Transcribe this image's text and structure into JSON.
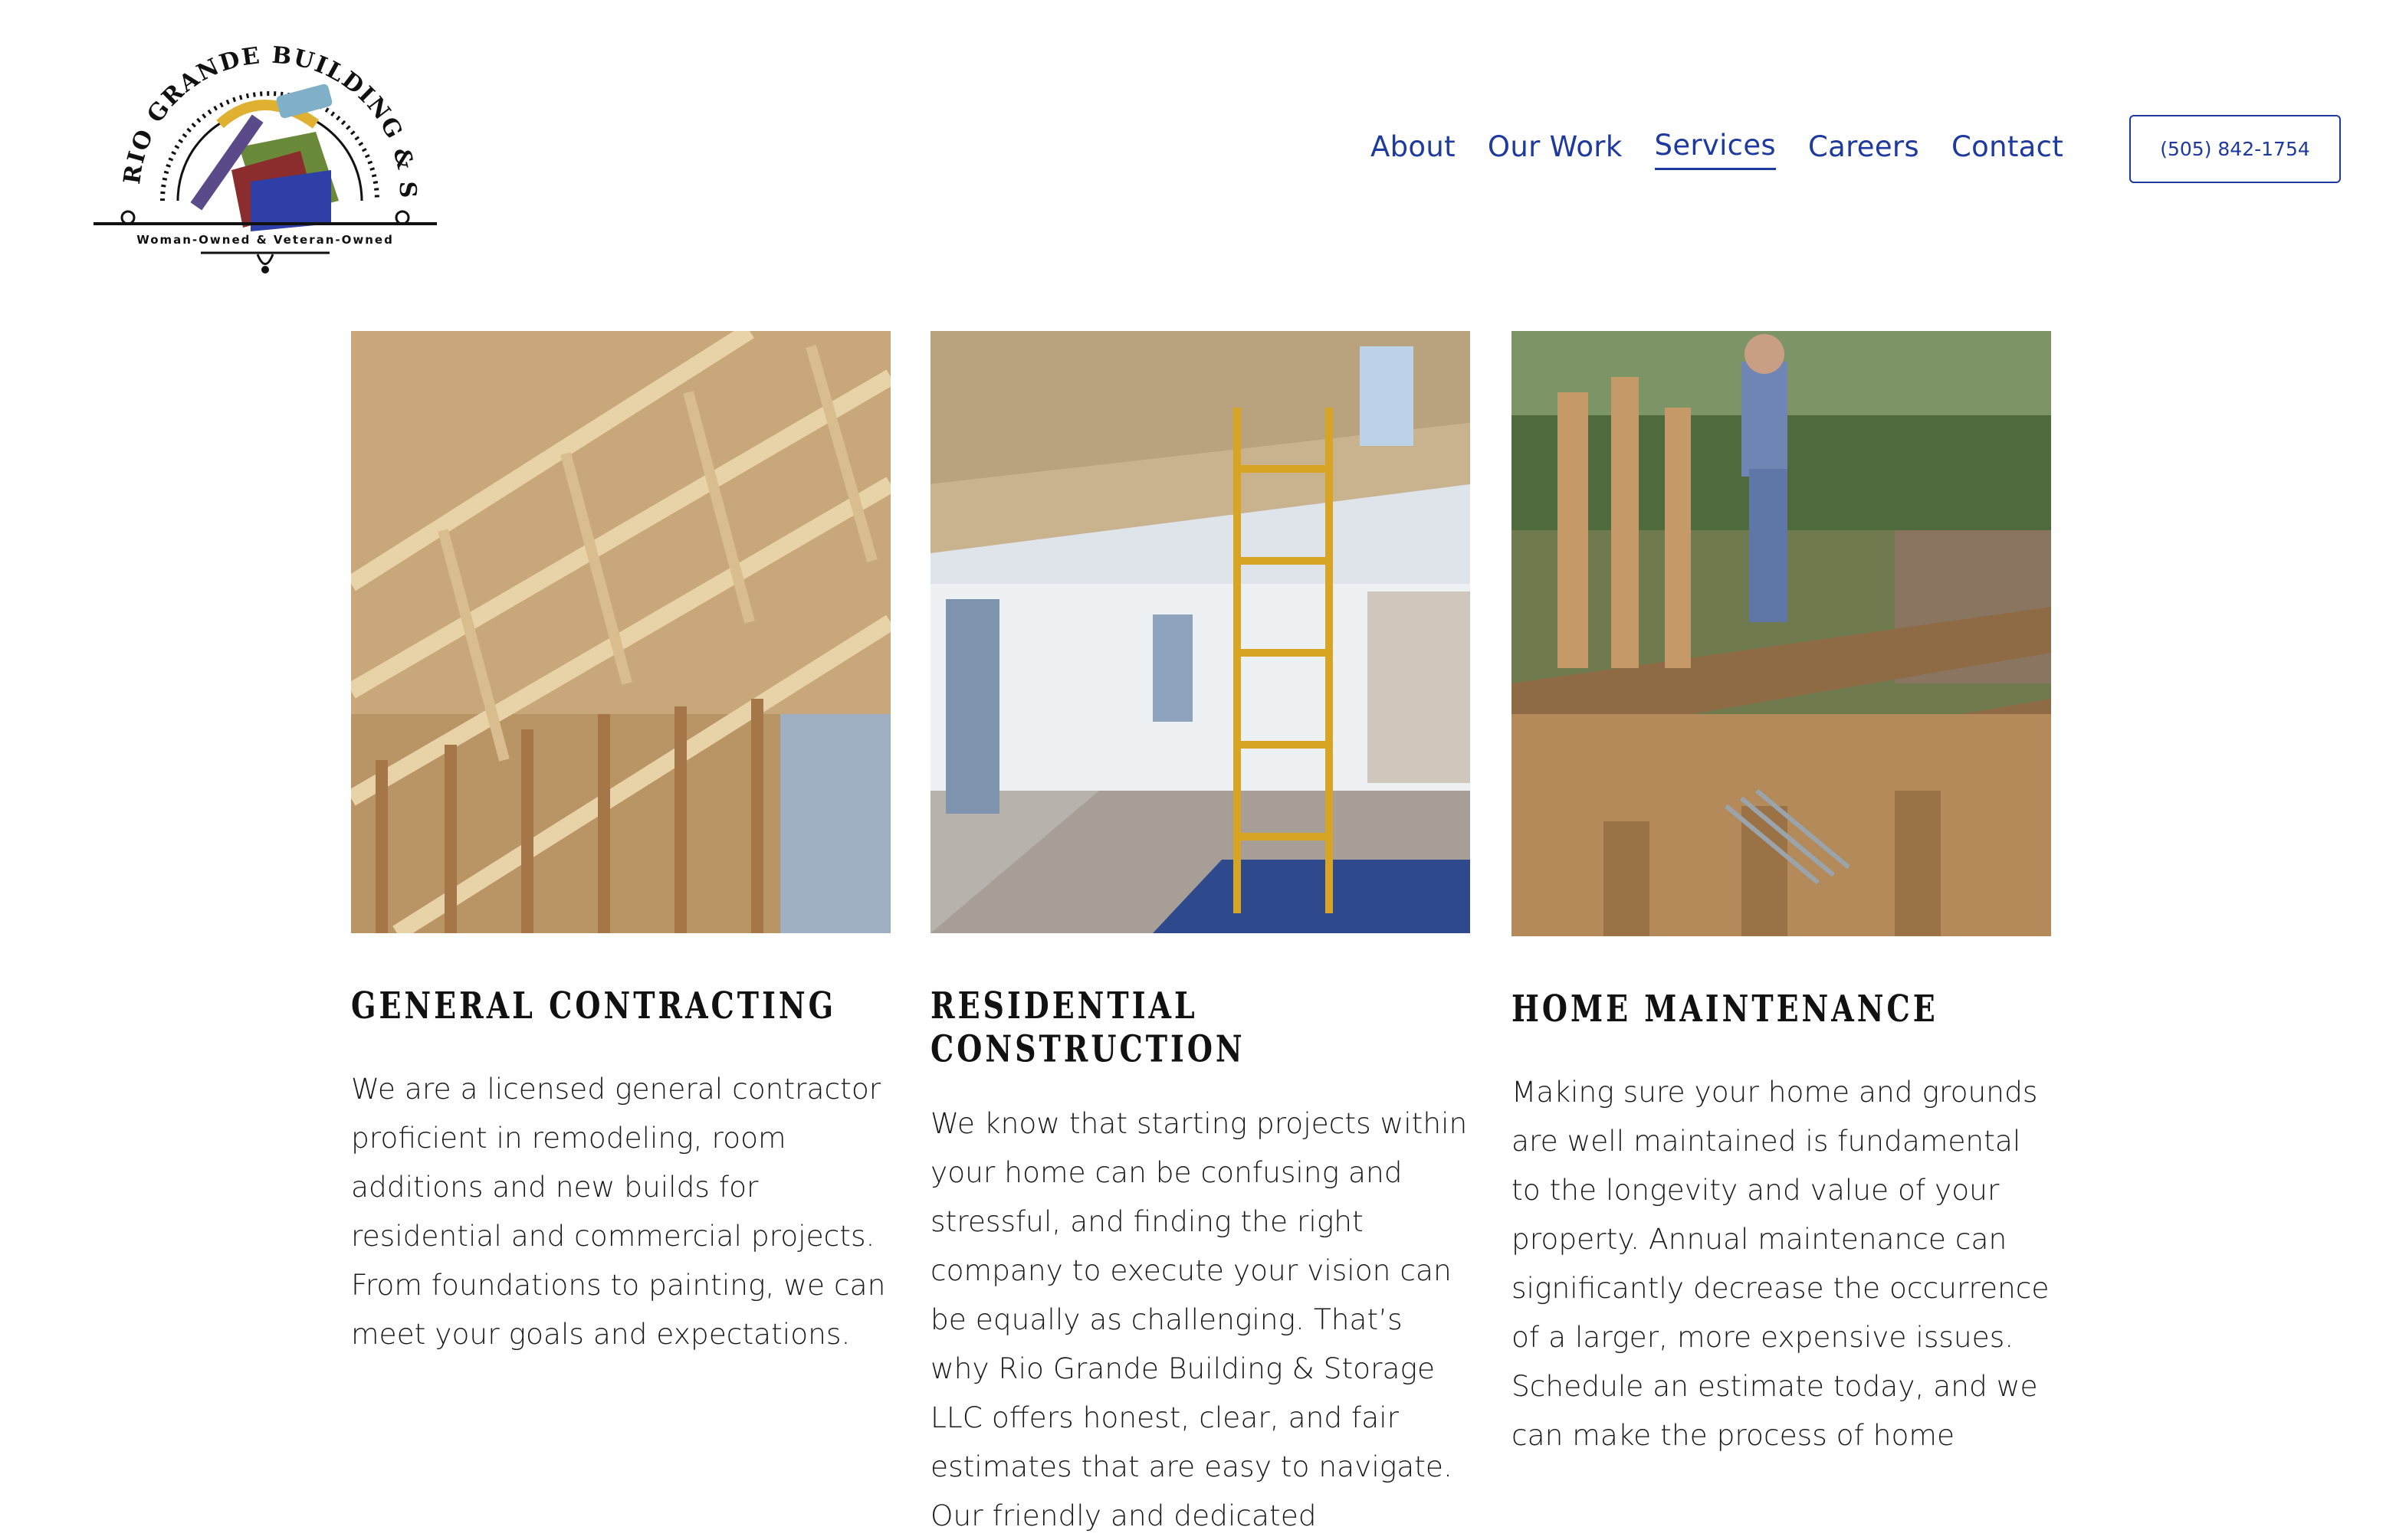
{
  "logo": {
    "arc_text": "RIO GRANDE BUILDING & STORAGE",
    "tagline": "Woman-Owned  &  Veteran-Owned"
  },
  "nav": {
    "items": [
      {
        "label": "About"
      },
      {
        "label": "Our Work"
      },
      {
        "label": "Services",
        "active": true
      },
      {
        "label": "Careers"
      },
      {
        "label": "Contact"
      }
    ]
  },
  "phone_button": {
    "label": "(505) 842-1754"
  },
  "colors": {
    "accent": "#1f3a9e",
    "background": "#ffffff",
    "text": "#1a1a1a"
  },
  "services": [
    {
      "title": "General Contracting",
      "image_icon": "roof-trusses-photo",
      "body": "We are a licensed general contractor proficient in remodeling, room additions and new builds for residential and commercial projects. From foundations to painting, we can meet your goals and expectations."
    },
    {
      "title": "Residential Construction",
      "image_icon": "interior-scaffolding-photo",
      "body": "We know that starting projects within your home can be confusing and stressful, and finding the right company to execute your vision can be equally as challenging. That’s why Rio Grande Building & Storage LLC offers honest, clear, and fair estimates that are easy to navigate. Our friendly and dedicated"
    },
    {
      "title": "Home Maintenance",
      "image_icon": "deck-demolition-photo",
      "body": "Making sure your home and grounds are well maintained is fundamental to the longevity and value of your property.  Annual maintenance can significantly decrease the occurrence of a larger, more expensive issues. Schedule an estimate today, and we can make the process of home"
    }
  ]
}
